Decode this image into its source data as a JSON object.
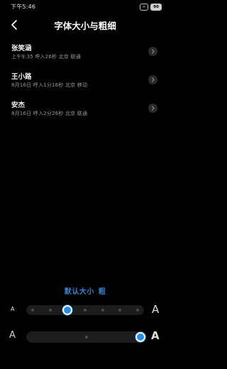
{
  "status_bar": {
    "time": "下午5:46",
    "box_x": "×",
    "battery": "90"
  },
  "header": {
    "title": "字体大小与粗细",
    "back_icon": "chevron-left-icon"
  },
  "calls": [
    {
      "name": "张笑涵",
      "detail": "上午9:35 呼入26秒 北京 联通"
    },
    {
      "name": "王小路",
      "detail": "8月16日 呼入1分16秒 北京 移动"
    },
    {
      "name": "安杰",
      "detail": "8月16日 呼入2分26秒 北京 联通"
    }
  ],
  "preview": {
    "size_label": "默认大小",
    "weight_label": "粗"
  },
  "size_slider": {
    "min_label": "A",
    "max_label": "A",
    "steps": 7,
    "selected_step": 2
  },
  "weight_slider": {
    "min_label": "A",
    "max_label": "A",
    "selected": "max"
  },
  "colors": {
    "accent": "#1f8ff0",
    "background": "#000000"
  }
}
